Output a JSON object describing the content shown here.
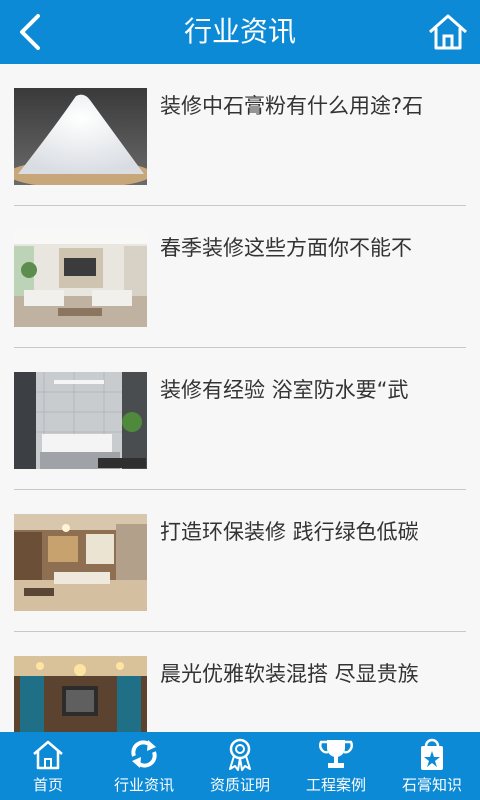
{
  "header": {
    "title": "行业资讯",
    "back_icon": "chevron-left-icon",
    "home_icon": "home-icon"
  },
  "articles": [
    {
      "title": "装修中石膏粉有什么用途?石",
      "image": "gypsum-powder-photo"
    },
    {
      "title": "春季装修这些方面你不能不",
      "image": "living-room-photo"
    },
    {
      "title": "装修有经验 浴室防水要“武",
      "image": "bathroom-photo"
    },
    {
      "title": "打造环保装修 践行绿色低碳",
      "image": "living-room-photo"
    },
    {
      "title": "晨光优雅软装混搭 尽显贵族",
      "image": "luxury-interior-photo"
    }
  ],
  "tabbar": {
    "items": [
      {
        "label": "首页",
        "icon": "home-icon"
      },
      {
        "label": "行业资讯",
        "icon": "refresh-icon"
      },
      {
        "label": "资质证明",
        "icon": "award-ribbon-icon"
      },
      {
        "label": "工程案例",
        "icon": "trophy-icon"
      },
      {
        "label": "石膏知识",
        "icon": "shopping-bag-star-icon"
      }
    ]
  },
  "colors": {
    "primary": "#0c8ad6",
    "background": "#f7f7f7",
    "text": "#333333",
    "divider": "#c8c8c8"
  }
}
